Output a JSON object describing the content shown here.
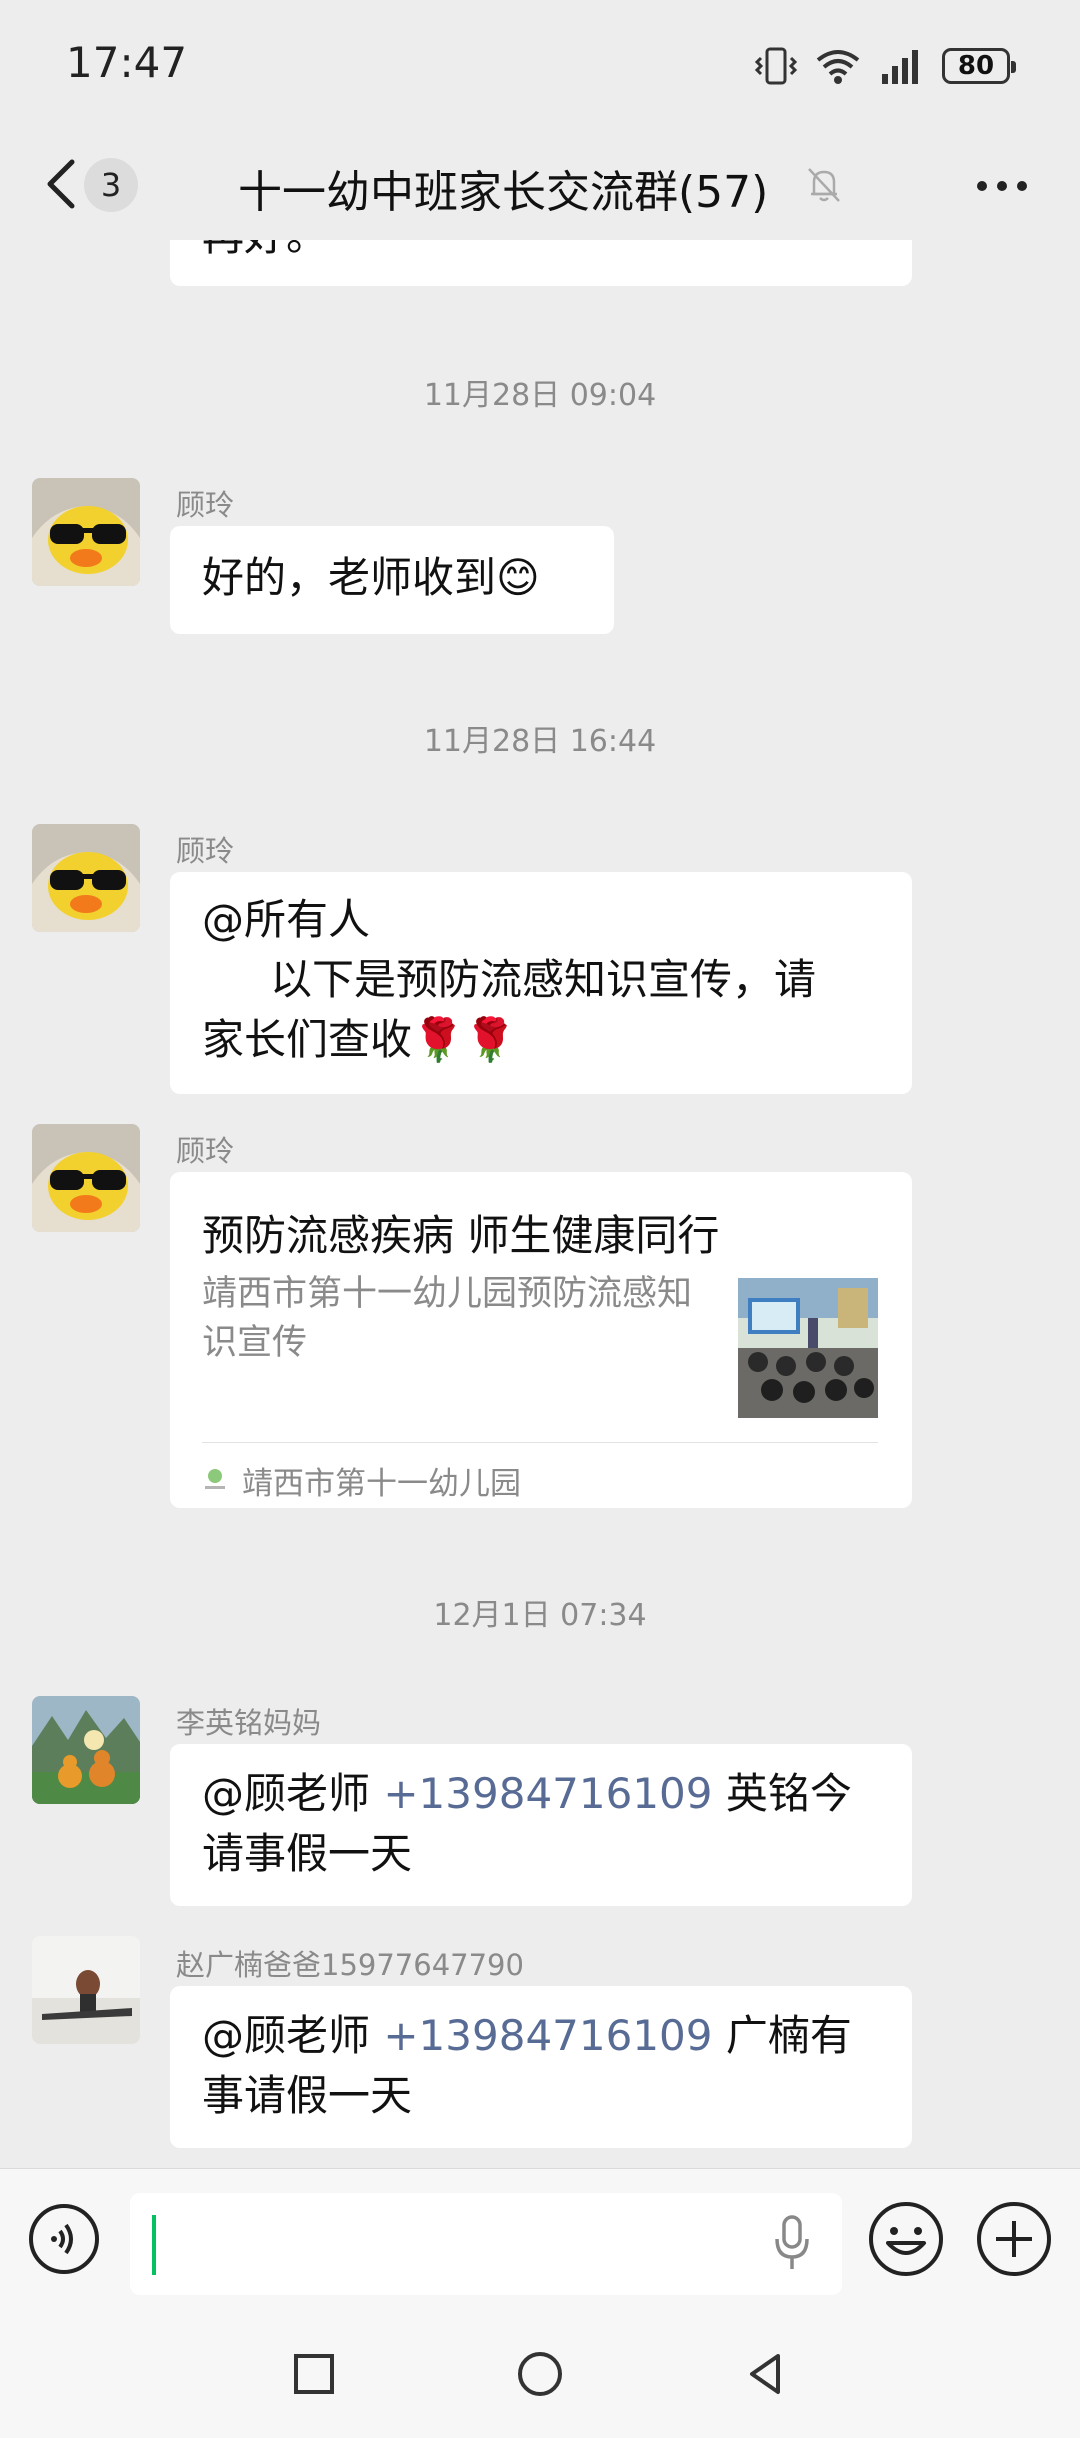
{
  "status_bar": {
    "time": "17:47",
    "battery": "80"
  },
  "header": {
    "unread_count": "3",
    "title": "十一幼中班家长交流群(57)"
  },
  "chat": {
    "partial_message": "再好。",
    "timestamps": [
      "11月28日 09:04",
      "11月28日 16:44",
      "12月1日 07:34"
    ],
    "messages": [
      {
        "sender": "顾玲",
        "text": "好的，老师收到😊"
      },
      {
        "sender": "顾玲",
        "line1": "@所有人",
        "line2": "以下是预防流感知识宣传，请",
        "line3": "家长们查收🌹🌹"
      },
      {
        "sender": "顾玲",
        "card": {
          "title": "预防流感疾病  师生健康同行",
          "desc": "靖西市第十一幼儿园预防流感知识宣传",
          "source": "靖西市第十一幼儿园"
        }
      },
      {
        "sender": "李英铭妈妈",
        "mention": "@顾老师 ",
        "phone": "+13984716109",
        "after": " 英铭今",
        "line2": "请事假一天"
      },
      {
        "sender": "赵广楠爸爸15977647790",
        "mention": "@顾老师 ",
        "phone": "+13984716109",
        "after": " 广楠有",
        "line2": "事请假一天"
      }
    ]
  },
  "input": {
    "placeholder": ""
  },
  "icons": {
    "back": "chevron-left-icon",
    "mute": "bell-off-icon",
    "more": "more-dots-icon",
    "voice": "voice-icon",
    "mic": "mic-icon",
    "emoji": "emoji-icon",
    "plus": "plus-icon"
  },
  "colors": {
    "background": "#EDEDED",
    "bubble": "#FFFFFF",
    "link": "#576B95",
    "caret": "#07C160"
  }
}
